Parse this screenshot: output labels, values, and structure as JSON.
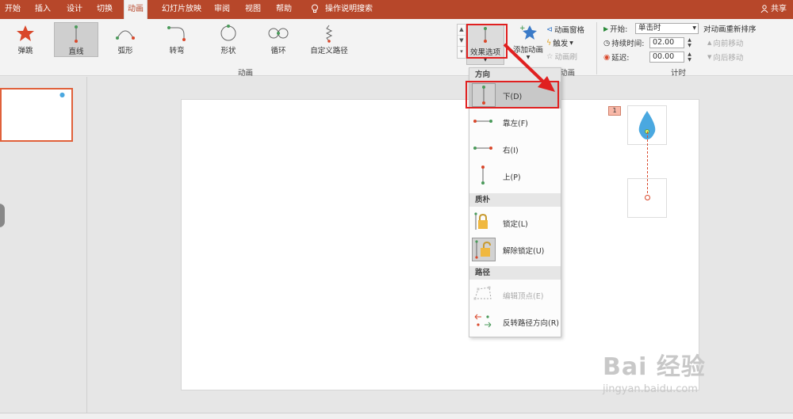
{
  "tabs": [
    "开始",
    "插入",
    "设计",
    "切换",
    "动画",
    "幻灯片放映",
    "审阅",
    "视图",
    "帮助",
    "操作说明搜索"
  ],
  "share": "共享",
  "animations": [
    "弹跳",
    "直线",
    "弧形",
    "转弯",
    "形状",
    "循环",
    "自定义路径"
  ],
  "effect_options_label": "效果选项",
  "add_animation_label": "添加动画",
  "adv": {
    "pane": "动画窗格",
    "trigger": "触发",
    "painter": "动画刷"
  },
  "timing": {
    "start_label": "开始:",
    "start_value": "单击时",
    "duration_label": "持续时间:",
    "duration_value": "02.00",
    "delay_label": "延迟:",
    "delay_value": "00.00"
  },
  "reorder": {
    "title": "对动画重新排序",
    "earlier": "向前移动",
    "later": "向后移动"
  },
  "groups": {
    "animation": "动画",
    "advanced": "动画",
    "timing": "计时"
  },
  "slide": {
    "anim_badge": "1"
  },
  "menu": {
    "direction_header": "方向",
    "direction_items": [
      "下(D)",
      "靠左(F)",
      "右(I)",
      "上(P)"
    ],
    "anchor_header": "质朴",
    "anchor_items": [
      "锁定(L)",
      "解除锁定(U)"
    ],
    "path_header": "路径",
    "path_items": [
      "编辑顶点(E)",
      "反转路径方向(R)"
    ]
  },
  "watermark": {
    "logo": "Bai 经验",
    "url": "jingyan.baidu.com"
  },
  "colors": {
    "brand": "#b7472a",
    "highlight": "#e02020",
    "accent_blue": "#4aa8e0"
  }
}
